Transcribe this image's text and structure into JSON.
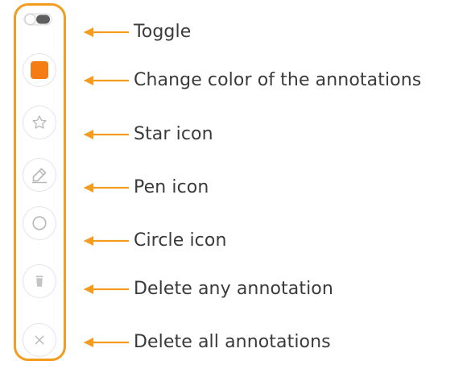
{
  "colors": {
    "accent": "#f39c1f",
    "annotation_color": "#f47c12",
    "icon_gray": "#c9c9c9",
    "text": "#3a3a3a"
  },
  "toolbar": {
    "items": [
      {
        "icon": "toggle-switch",
        "label": "Toggle"
      },
      {
        "icon": "color-swatch",
        "label": "Change color of the annotations"
      },
      {
        "icon": "star-icon",
        "label": "Star icon"
      },
      {
        "icon": "pen-icon",
        "label": "Pen icon"
      },
      {
        "icon": "circle-icon",
        "label": "Circle icon"
      },
      {
        "icon": "trash-icon",
        "label": "Delete any annotation"
      },
      {
        "icon": "close-icon",
        "label": "Delete all annotations"
      }
    ]
  }
}
